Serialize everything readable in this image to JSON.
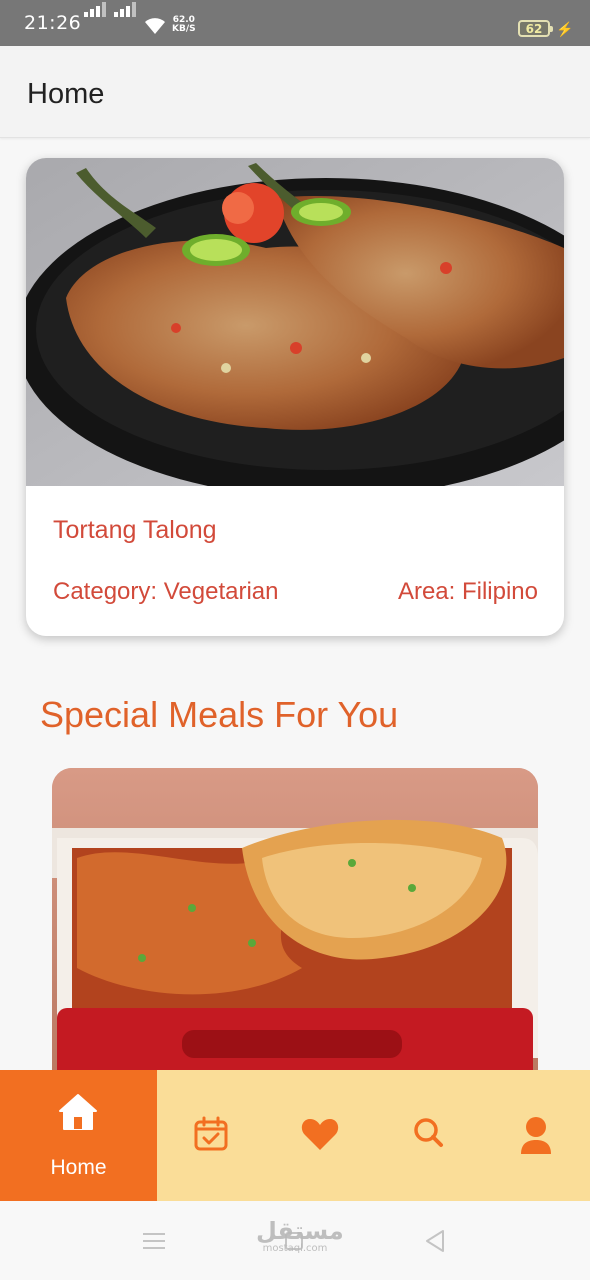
{
  "status_bar": {
    "time": "21:26",
    "net_speed_value": "62.0",
    "net_speed_unit": "KB/S",
    "battery_level": "62",
    "icons": [
      "signal-icon",
      "signal-icon",
      "wifi-icon",
      "battery-icon",
      "charging-bolt-icon"
    ]
  },
  "app_bar": {
    "title": "Home"
  },
  "featured_meal": {
    "name": "Tortang Talong",
    "category": "Category: Vegetarian",
    "area": "Area: Filipino",
    "image_icon": "meal-photo"
  },
  "special_section": {
    "title": "Special Meals For You",
    "image_icon": "special-meal-photo"
  },
  "bottom_nav": {
    "items": [
      {
        "label": "Home",
        "icon": "home-icon",
        "active": true
      },
      {
        "icon": "calendar-check-icon"
      },
      {
        "icon": "heart-icon"
      },
      {
        "icon": "search-icon"
      },
      {
        "icon": "user-icon"
      }
    ],
    "active_color": "#f26f21",
    "bar_color": "#fadd98"
  },
  "watermark": {
    "arabic": "مستقل",
    "latin": "mostaql.com"
  },
  "colors": {
    "accent": "#f26f21",
    "meal_text": "#d24a3a",
    "section_title": "#e0622a"
  }
}
